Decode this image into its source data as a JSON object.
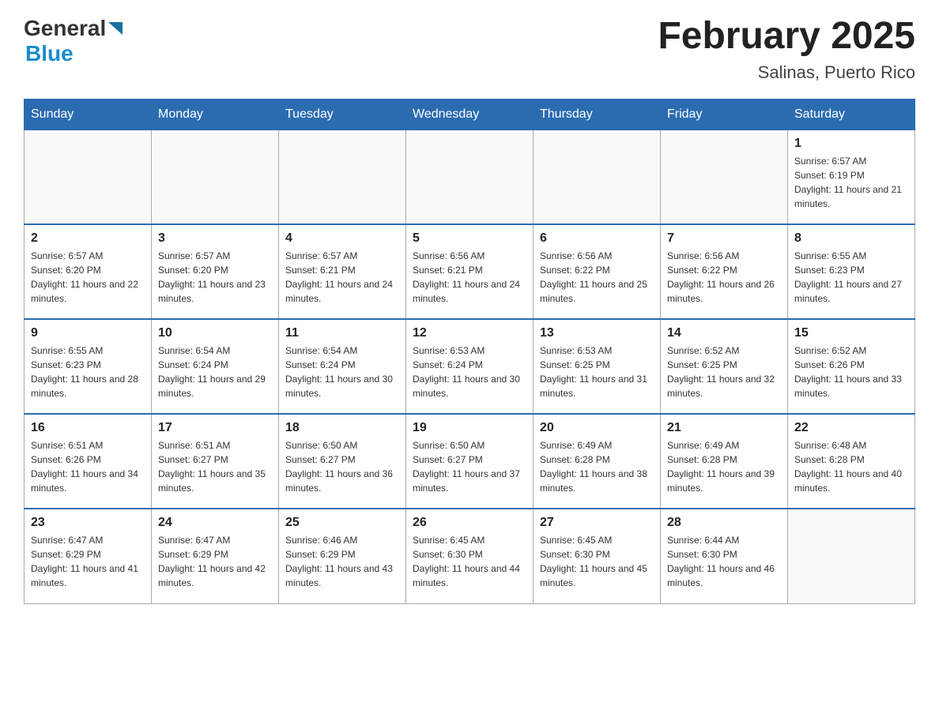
{
  "header": {
    "title": "February 2025",
    "subtitle": "Salinas, Puerto Rico"
  },
  "logo": {
    "general": "General",
    "blue": "Blue"
  },
  "days_of_week": [
    "Sunday",
    "Monday",
    "Tuesday",
    "Wednesday",
    "Thursday",
    "Friday",
    "Saturday"
  ],
  "weeks": [
    [
      {
        "day": "",
        "sunrise": "",
        "sunset": "",
        "daylight": ""
      },
      {
        "day": "",
        "sunrise": "",
        "sunset": "",
        "daylight": ""
      },
      {
        "day": "",
        "sunrise": "",
        "sunset": "",
        "daylight": ""
      },
      {
        "day": "",
        "sunrise": "",
        "sunset": "",
        "daylight": ""
      },
      {
        "day": "",
        "sunrise": "",
        "sunset": "",
        "daylight": ""
      },
      {
        "day": "",
        "sunrise": "",
        "sunset": "",
        "daylight": ""
      },
      {
        "day": "1",
        "sunrise": "Sunrise: 6:57 AM",
        "sunset": "Sunset: 6:19 PM",
        "daylight": "Daylight: 11 hours and 21 minutes."
      }
    ],
    [
      {
        "day": "2",
        "sunrise": "Sunrise: 6:57 AM",
        "sunset": "Sunset: 6:20 PM",
        "daylight": "Daylight: 11 hours and 22 minutes."
      },
      {
        "day": "3",
        "sunrise": "Sunrise: 6:57 AM",
        "sunset": "Sunset: 6:20 PM",
        "daylight": "Daylight: 11 hours and 23 minutes."
      },
      {
        "day": "4",
        "sunrise": "Sunrise: 6:57 AM",
        "sunset": "Sunset: 6:21 PM",
        "daylight": "Daylight: 11 hours and 24 minutes."
      },
      {
        "day": "5",
        "sunrise": "Sunrise: 6:56 AM",
        "sunset": "Sunset: 6:21 PM",
        "daylight": "Daylight: 11 hours and 24 minutes."
      },
      {
        "day": "6",
        "sunrise": "Sunrise: 6:56 AM",
        "sunset": "Sunset: 6:22 PM",
        "daylight": "Daylight: 11 hours and 25 minutes."
      },
      {
        "day": "7",
        "sunrise": "Sunrise: 6:56 AM",
        "sunset": "Sunset: 6:22 PM",
        "daylight": "Daylight: 11 hours and 26 minutes."
      },
      {
        "day": "8",
        "sunrise": "Sunrise: 6:55 AM",
        "sunset": "Sunset: 6:23 PM",
        "daylight": "Daylight: 11 hours and 27 minutes."
      }
    ],
    [
      {
        "day": "9",
        "sunrise": "Sunrise: 6:55 AM",
        "sunset": "Sunset: 6:23 PM",
        "daylight": "Daylight: 11 hours and 28 minutes."
      },
      {
        "day": "10",
        "sunrise": "Sunrise: 6:54 AM",
        "sunset": "Sunset: 6:24 PM",
        "daylight": "Daylight: 11 hours and 29 minutes."
      },
      {
        "day": "11",
        "sunrise": "Sunrise: 6:54 AM",
        "sunset": "Sunset: 6:24 PM",
        "daylight": "Daylight: 11 hours and 30 minutes."
      },
      {
        "day": "12",
        "sunrise": "Sunrise: 6:53 AM",
        "sunset": "Sunset: 6:24 PM",
        "daylight": "Daylight: 11 hours and 30 minutes."
      },
      {
        "day": "13",
        "sunrise": "Sunrise: 6:53 AM",
        "sunset": "Sunset: 6:25 PM",
        "daylight": "Daylight: 11 hours and 31 minutes."
      },
      {
        "day": "14",
        "sunrise": "Sunrise: 6:52 AM",
        "sunset": "Sunset: 6:25 PM",
        "daylight": "Daylight: 11 hours and 32 minutes."
      },
      {
        "day": "15",
        "sunrise": "Sunrise: 6:52 AM",
        "sunset": "Sunset: 6:26 PM",
        "daylight": "Daylight: 11 hours and 33 minutes."
      }
    ],
    [
      {
        "day": "16",
        "sunrise": "Sunrise: 6:51 AM",
        "sunset": "Sunset: 6:26 PM",
        "daylight": "Daylight: 11 hours and 34 minutes."
      },
      {
        "day": "17",
        "sunrise": "Sunrise: 6:51 AM",
        "sunset": "Sunset: 6:27 PM",
        "daylight": "Daylight: 11 hours and 35 minutes."
      },
      {
        "day": "18",
        "sunrise": "Sunrise: 6:50 AM",
        "sunset": "Sunset: 6:27 PM",
        "daylight": "Daylight: 11 hours and 36 minutes."
      },
      {
        "day": "19",
        "sunrise": "Sunrise: 6:50 AM",
        "sunset": "Sunset: 6:27 PM",
        "daylight": "Daylight: 11 hours and 37 minutes."
      },
      {
        "day": "20",
        "sunrise": "Sunrise: 6:49 AM",
        "sunset": "Sunset: 6:28 PM",
        "daylight": "Daylight: 11 hours and 38 minutes."
      },
      {
        "day": "21",
        "sunrise": "Sunrise: 6:49 AM",
        "sunset": "Sunset: 6:28 PM",
        "daylight": "Daylight: 11 hours and 39 minutes."
      },
      {
        "day": "22",
        "sunrise": "Sunrise: 6:48 AM",
        "sunset": "Sunset: 6:28 PM",
        "daylight": "Daylight: 11 hours and 40 minutes."
      }
    ],
    [
      {
        "day": "23",
        "sunrise": "Sunrise: 6:47 AM",
        "sunset": "Sunset: 6:29 PM",
        "daylight": "Daylight: 11 hours and 41 minutes."
      },
      {
        "day": "24",
        "sunrise": "Sunrise: 6:47 AM",
        "sunset": "Sunset: 6:29 PM",
        "daylight": "Daylight: 11 hours and 42 minutes."
      },
      {
        "day": "25",
        "sunrise": "Sunrise: 6:46 AM",
        "sunset": "Sunset: 6:29 PM",
        "daylight": "Daylight: 11 hours and 43 minutes."
      },
      {
        "day": "26",
        "sunrise": "Sunrise: 6:45 AM",
        "sunset": "Sunset: 6:30 PM",
        "daylight": "Daylight: 11 hours and 44 minutes."
      },
      {
        "day": "27",
        "sunrise": "Sunrise: 6:45 AM",
        "sunset": "Sunset: 6:30 PM",
        "daylight": "Daylight: 11 hours and 45 minutes."
      },
      {
        "day": "28",
        "sunrise": "Sunrise: 6:44 AM",
        "sunset": "Sunset: 6:30 PM",
        "daylight": "Daylight: 11 hours and 46 minutes."
      },
      {
        "day": "",
        "sunrise": "",
        "sunset": "",
        "daylight": ""
      }
    ]
  ]
}
